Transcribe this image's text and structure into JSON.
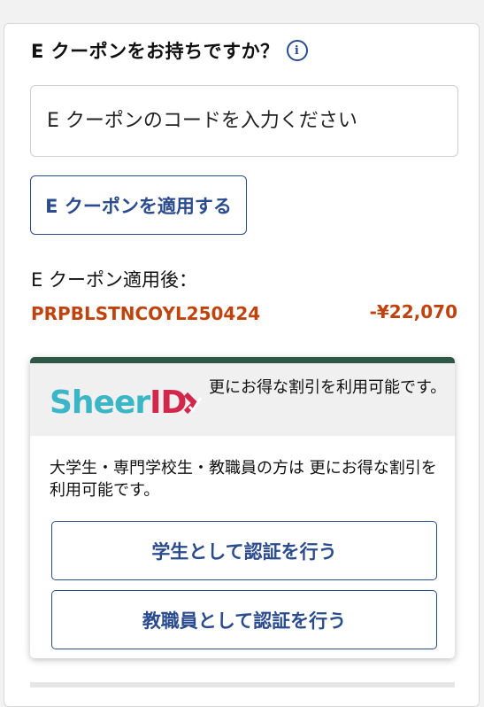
{
  "coupon_section": {
    "heading": "E クーポンをお持ちですか？",
    "info_icon_glyph": "i",
    "input_placeholder": "E クーポンのコードを入力ください",
    "apply_label": "E クーポンを適用する",
    "applied_label": "E クーポン適用後：",
    "applied_code": "PRPBLSTNCOYL250424",
    "applied_discount": "-¥22,070"
  },
  "sheerid": {
    "logo_text_main": "Sheer",
    "logo_text_id": "ID",
    "header_text": "更にお得な割引を利用可能です。",
    "body_text": "大学生・専門学校生・教職員の方は 更にお得な割引を利用可能です。",
    "student_button": "学生として認証を行う",
    "staff_button": "教職員として認証を行う"
  },
  "colors": {
    "accent_blue": "#2a4b8d",
    "discount_orange": "#c0420d",
    "sheer_teal": "#3ab6c6",
    "sheer_red": "#d2264a",
    "card_top_bar": "#2e5747"
  }
}
